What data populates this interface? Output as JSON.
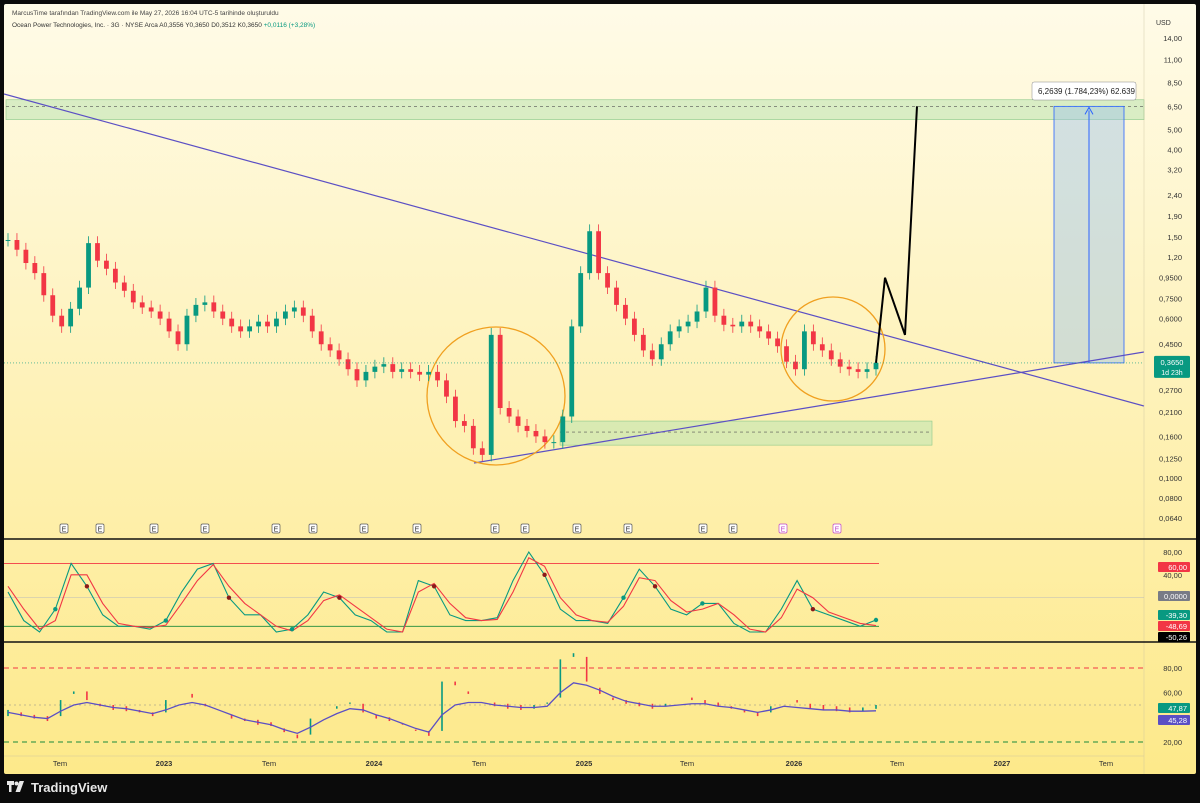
{
  "header": {
    "attribution": "MarcusTime tarafından TradingView.com ile May 27, 2026 16:04 UTC-5 tarihinde oluşturuldu"
  },
  "symbol": {
    "name": "Ocean Power Technologies, Inc. · 3G · NYSE Arca",
    "ohlc": "A0,3556 Y0,3650 D0,3512 K0,3650",
    "change": "+0,0116 (+3,28%)"
  },
  "footer": {
    "brand": "TradingView"
  },
  "colors": {
    "bg_top": "#fffbe8",
    "bg_bottom": "#fde98a",
    "up": "#089981",
    "down": "#f23645",
    "trendline": "#5b4fc4",
    "circle": "#f0a020",
    "zone": "#b9e3b0"
  },
  "chart_data": [
    {
      "type": "line",
      "panel": "price",
      "currency_label": "USD",
      "scale": "log",
      "y_ticks": [
        "14,00",
        "11,00",
        "8,50",
        "6,50",
        "5,00",
        "4,00",
        "3,20",
        "2,40",
        "1,90",
        "1,50",
        "1,20",
        "0,9500",
        "0,7500",
        "0,6000",
        "0,4500",
        "0,3500",
        "0,2700",
        "0,2100",
        "0,1600",
        "0,1250",
        "0,1000",
        "0,0800",
        "0,0640"
      ],
      "x_ticks": [
        "Tem",
        "2023",
        "Tem",
        "2024",
        "Tem",
        "2025",
        "Tem",
        "2026",
        "Tem",
        "2027",
        "Tem"
      ],
      "last_price_label": "0,3650",
      "countdown_label": "1d 23h",
      "measure_label": "6,2639 (1.784,23%) 62.639",
      "series": [
        {
          "values": [
            1.45,
            1.3,
            1.12,
            1.0,
            0.78,
            0.62,
            0.55,
            0.67,
            0.85,
            1.4,
            1.15,
            1.05,
            0.9,
            0.82,
            0.72,
            0.68,
            0.65,
            0.6,
            0.52,
            0.45,
            0.62,
            0.7,
            0.72,
            0.65,
            0.6,
            0.55,
            0.52,
            0.55,
            0.58,
            0.55,
            0.6,
            0.65,
            0.68,
            0.62,
            0.52,
            0.45,
            0.42,
            0.38,
            0.34,
            0.3,
            0.33,
            0.35,
            0.36,
            0.33,
            0.34,
            0.33,
            0.32,
            0.33,
            0.3,
            0.25,
            0.19,
            0.18,
            0.14,
            0.13,
            0.5,
            0.22,
            0.2,
            0.18,
            0.17,
            0.16,
            0.15,
            0.15,
            0.2,
            0.55,
            1.0,
            1.6,
            1.0,
            0.85,
            0.7,
            0.6,
            0.5,
            0.42,
            0.38,
            0.45,
            0.52,
            0.55,
            0.58,
            0.65,
            0.85,
            0.62,
            0.56,
            0.55,
            0.58,
            0.55,
            0.52,
            0.48,
            0.44,
            0.37,
            0.34,
            0.52,
            0.45,
            0.42,
            0.38,
            0.35,
            0.34,
            0.33,
            0.34,
            0.365
          ]
        }
      ],
      "annotations": [
        {
          "kind": "resistance-zone",
          "low": 5.6,
          "high": 7.0
        },
        {
          "kind": "support-zone",
          "low": 0.145,
          "high": 0.19
        },
        {
          "kind": "projection-path",
          "values": [
            0.365,
            0.95,
            0.5,
            6.5
          ]
        },
        {
          "kind": "measure-target",
          "from": 0.365,
          "to": 6.5
        }
      ],
      "event_markers": [
        "E",
        "E",
        "E",
        "E",
        "E",
        "E",
        "E",
        "E",
        "E",
        "E",
        "E",
        "E",
        "E",
        "E",
        "E",
        "E"
      ]
    },
    {
      "type": "line",
      "panel": "oscillator",
      "y_ticks": [
        "80,00",
        "40,00"
      ],
      "levels": [
        60,
        -50
      ],
      "labels": [
        "60,00",
        "0,0000",
        "-39,30",
        "-48,69",
        "-50,26"
      ],
      "label_colors": [
        "#f23645",
        "#787b86",
        "#089981",
        "#f23645",
        "#000000"
      ],
      "series": [
        {
          "name": "fast",
          "color": "#089981",
          "values": [
            10,
            -40,
            -60,
            -20,
            60,
            20,
            -30,
            -50,
            -50,
            -55,
            -40,
            10,
            50,
            60,
            0,
            -30,
            -30,
            -60,
            -55,
            -30,
            10,
            0,
            -30,
            -40,
            -60,
            -60,
            30,
            20,
            -30,
            -40,
            -40,
            -35,
            30,
            80,
            40,
            -20,
            -40,
            -40,
            -45,
            0,
            50,
            20,
            -20,
            -30,
            -10,
            -10,
            -45,
            -60,
            -60,
            -20,
            30,
            -20,
            -30,
            -40,
            -50,
            -39
          ]
        },
        {
          "name": "slow",
          "color": "#f23645",
          "values": [
            20,
            -20,
            -55,
            -40,
            40,
            40,
            -10,
            -45,
            -50,
            -52,
            -48,
            -10,
            30,
            58,
            20,
            -10,
            -30,
            -50,
            -58,
            -40,
            -5,
            5,
            -15,
            -35,
            -55,
            -60,
            10,
            25,
            -10,
            -35,
            -40,
            -38,
            10,
            70,
            55,
            0,
            -30,
            -40,
            -43,
            -15,
            35,
            30,
            -5,
            -25,
            -20,
            -10,
            -30,
            -55,
            -60,
            -35,
            15,
            0,
            -25,
            -35,
            -45,
            -48.7
          ]
        }
      ]
    },
    {
      "type": "line",
      "panel": "rsi",
      "y_ticks": [
        "80,00",
        "60,00",
        "20,00"
      ],
      "levels": [
        80,
        50,
        20
      ],
      "labels": [
        "47,87",
        "45,28"
      ],
      "label_colors": [
        "#089981",
        "#5b4fc4"
      ],
      "series": [
        {
          "name": "rsi",
          "color": "#089981",
          "values": [
            42,
            40,
            38,
            37,
            55,
            62,
            50,
            47,
            46,
            45,
            42,
            40,
            55,
            60,
            52,
            45,
            40,
            38,
            35,
            34,
            32,
            24,
            22,
            40,
            45,
            48,
            52,
            40,
            38,
            36,
            30,
            26,
            25,
            70,
            62,
            55,
            50,
            48,
            47,
            46,
            48,
            52,
            88,
            90,
            65,
            55,
            52,
            50,
            48,
            47,
            50,
            55,
            52,
            50,
            48,
            45,
            42,
            40,
            50,
            55,
            48,
            47,
            46,
            45,
            44,
            46,
            47.9
          ]
        },
        {
          "name": "ma",
          "color": "#5b4fc4",
          "values": [
            44,
            42,
            40,
            39,
            45,
            50,
            52,
            50,
            48,
            47,
            45,
            43,
            46,
            50,
            52,
            50,
            46,
            42,
            38,
            36,
            34,
            30,
            27,
            32,
            38,
            43,
            47,
            46,
            42,
            39,
            35,
            31,
            28,
            42,
            50,
            52,
            52,
            50,
            49,
            48,
            48,
            49,
            60,
            68,
            66,
            62,
            57,
            53,
            51,
            49,
            49,
            50,
            51,
            51,
            49,
            48,
            46,
            44,
            46,
            49,
            48,
            47,
            46,
            46,
            45,
            45,
            45.3
          ]
        }
      ]
    }
  ]
}
